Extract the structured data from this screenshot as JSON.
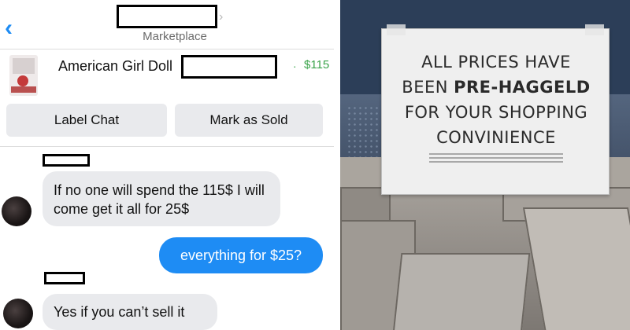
{
  "chat": {
    "header": {
      "subtitle": "Marketplace",
      "back_icon": "chevron-left-icon"
    },
    "listing": {
      "title": "American Girl Doll",
      "price_separator": "·",
      "price": "$115",
      "price_color": "#3aa34a"
    },
    "actions": {
      "label_chat": "Label Chat",
      "mark_sold": "Mark as Sold"
    },
    "messages": [
      {
        "direction": "incoming",
        "text": "If no one will spend the 115$ I will come get it all for 25$"
      },
      {
        "direction": "outgoing",
        "text": "everything for $25?"
      },
      {
        "direction": "incoming",
        "text": "Yes if you can’t sell it"
      }
    ],
    "accent_color": "#1e8cf4"
  },
  "photo": {
    "sign": {
      "line1": "ALL PRICES HAVE",
      "line2_prefix": "BEEN ",
      "line2_bold": "PRE-HAGGELD",
      "line3": "FOR YOUR SHOPPING",
      "line4": "CONVINIENCE"
    }
  }
}
